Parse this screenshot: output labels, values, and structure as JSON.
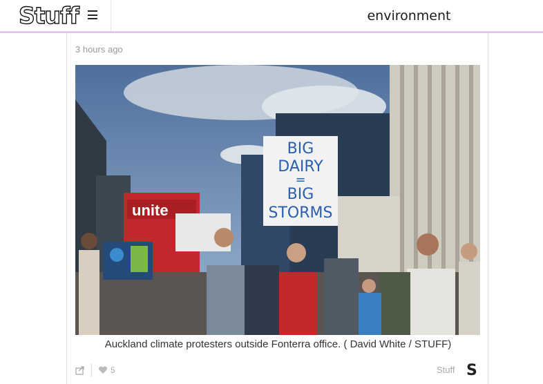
{
  "header": {
    "logo": "Stuff",
    "menu_icon": "hamburger-icon",
    "section_title": "environment"
  },
  "article": {
    "timestamp": "3 hours ago",
    "image_description_alt": "Auckland climate protesters outside Fonterra office.",
    "sign_text": [
      "BIG",
      "DAIRY",
      "=",
      "BIG",
      "STORMS"
    ],
    "caption": "Auckland climate protesters outside Fonterra office. ( David White / STUFF)",
    "footer": {
      "share_icon": "share-icon",
      "like_icon": "heart-icon",
      "likes": "5",
      "source": "Stuff",
      "source_icon": "S"
    }
  },
  "colors": {
    "accent_border": "#e3c6f2"
  }
}
